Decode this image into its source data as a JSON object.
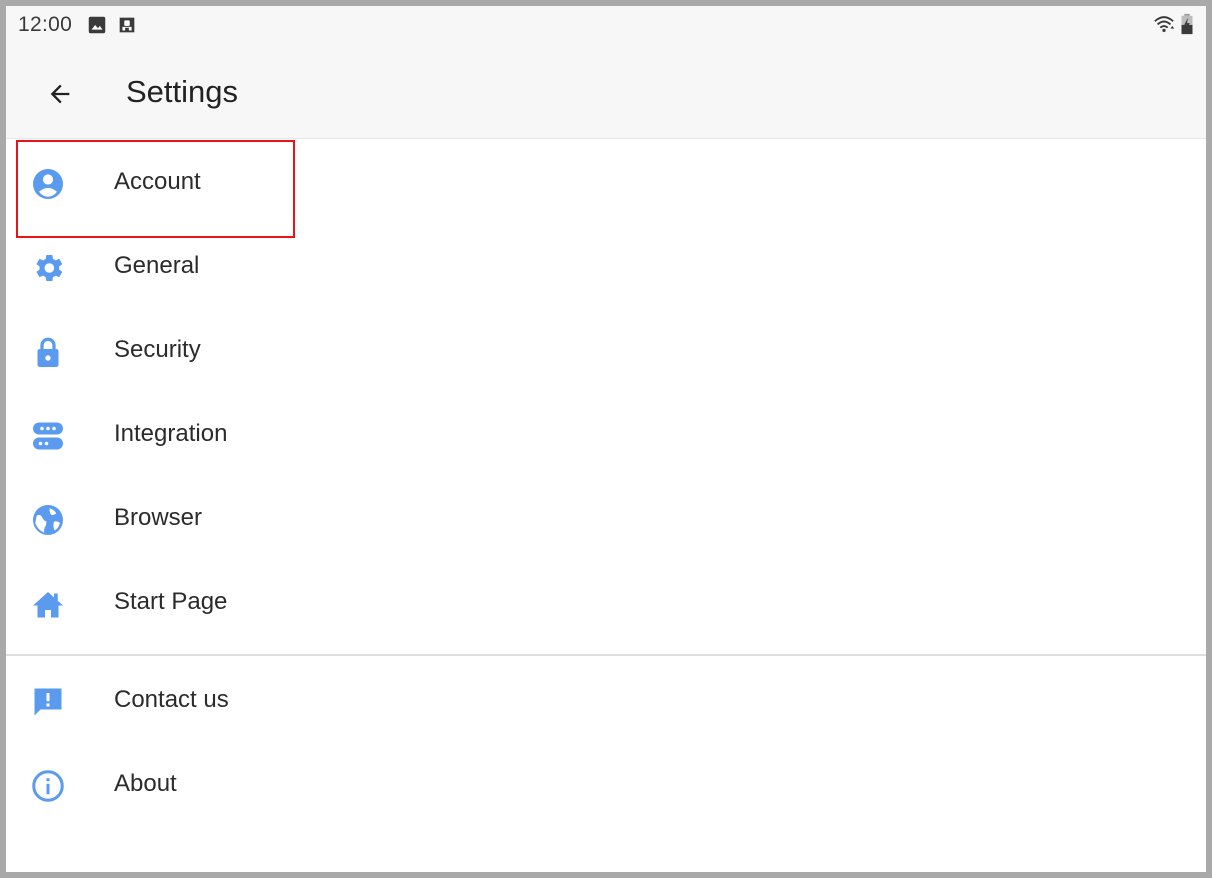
{
  "status_bar": {
    "time": "12:00",
    "icons": [
      "image-icon",
      "sim-card-alert-icon",
      "wifi-icon",
      "battery-charging-icon"
    ]
  },
  "app_bar": {
    "back_icon": "arrow-back-icon",
    "title": "Settings"
  },
  "colors": {
    "icon_blue": "#5a9bf0",
    "highlight": "#e8141a",
    "text": "#2b2b2b"
  },
  "menu": {
    "items": [
      {
        "label": "Account",
        "icon": "account-circle-icon"
      },
      {
        "label": "General",
        "icon": "gear-icon"
      },
      {
        "label": "Security",
        "icon": "lock-icon"
      },
      {
        "label": "Integration",
        "icon": "integration-icon"
      },
      {
        "label": "Browser",
        "icon": "globe-icon"
      },
      {
        "label": "Start Page",
        "icon": "home-icon"
      }
    ],
    "secondary": [
      {
        "label": "Contact us",
        "icon": "feedback-icon"
      },
      {
        "label": "About",
        "icon": "info-icon"
      }
    ]
  }
}
